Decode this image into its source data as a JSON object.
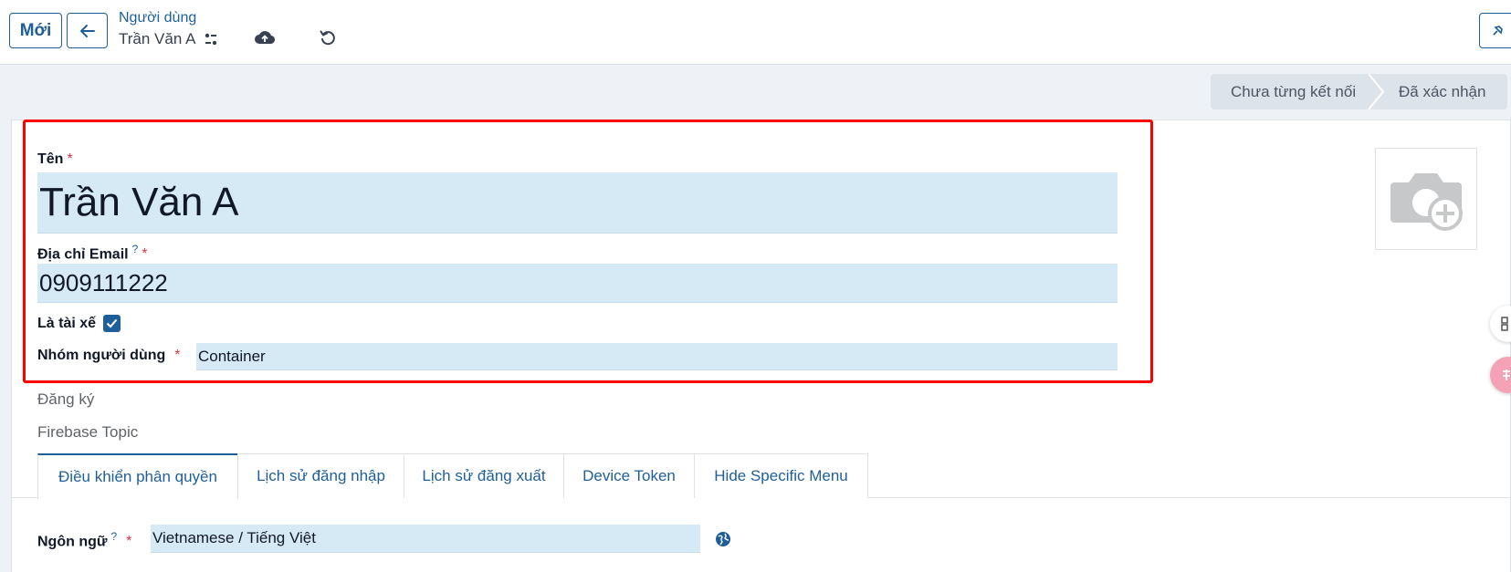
{
  "topbar": {
    "new_label": "Mới",
    "breadcrumb_parent": "Người dùng",
    "breadcrumb_current": "Trần Văn A"
  },
  "status": {
    "stages": [
      "Chưa từng kết nối",
      "Đã xác nhận"
    ]
  },
  "form": {
    "name_label": "Tên",
    "name_value": "Trần Văn A",
    "email_label": "Địa chỉ Email",
    "email_help": "?",
    "email_value": "0909111222",
    "driver_label": "Là tài xế",
    "driver_checked": true,
    "group_label": "Nhóm người dùng",
    "group_value": "Container",
    "register_label": "Đăng ký",
    "firebase_label": "Firebase Topic",
    "required_mark": "*"
  },
  "tabs": [
    {
      "label": "Điều khiển phân quyền",
      "active": true
    },
    {
      "label": "Lịch sử đăng nhập",
      "active": false
    },
    {
      "label": "Lịch sử đăng xuất",
      "active": false
    },
    {
      "label": "Device Token",
      "active": false
    },
    {
      "label": "Hide Specific Menu",
      "active": false
    }
  ],
  "language": {
    "label": "Ngôn ngữ",
    "help": "?",
    "value": "Vietnamese / Tiếng Việt"
  },
  "colors": {
    "accent": "#1f5f99",
    "field_bg": "#d6eaf6",
    "highlight_box": "#ff0000"
  }
}
